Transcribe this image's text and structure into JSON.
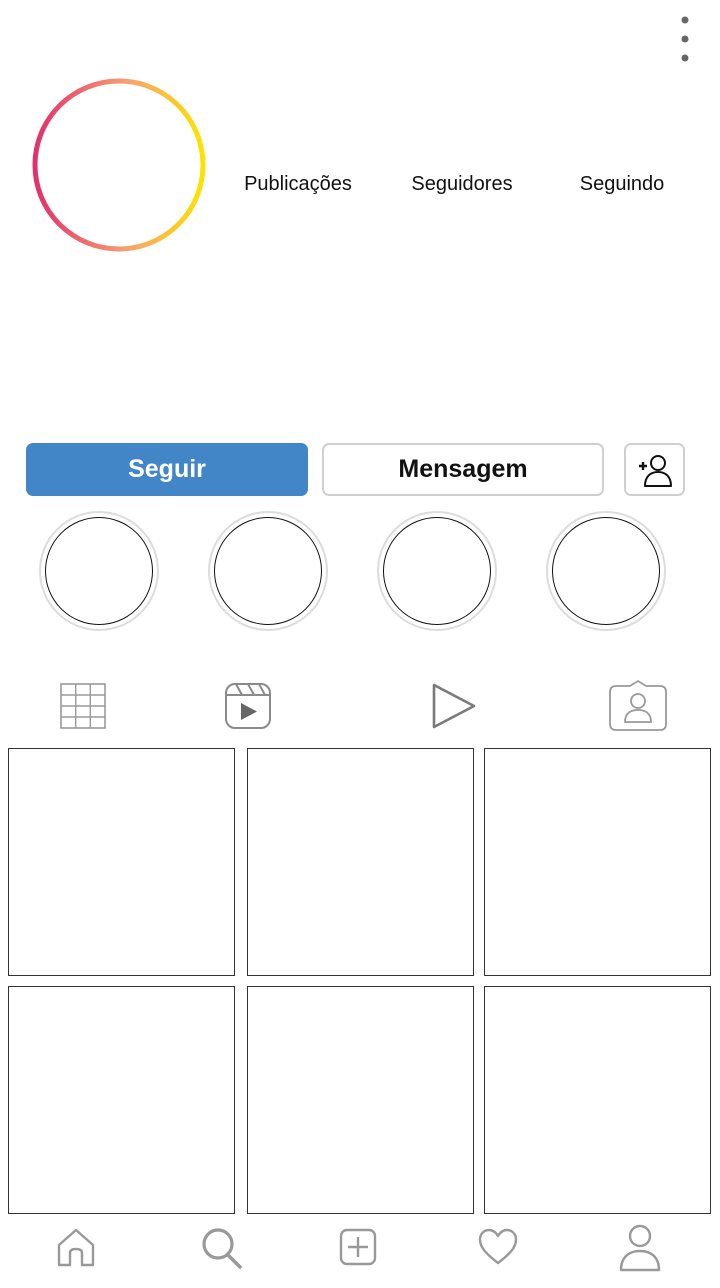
{
  "header": {
    "menu_icon": "vertical-dots-icon"
  },
  "profile": {
    "avatar_ring_colors": [
      "#e1306c",
      "#f77737",
      "#fcd700"
    ],
    "stats": [
      {
        "label": "Publicações"
      },
      {
        "label": "Seguidores"
      },
      {
        "label": "Seguindo"
      }
    ]
  },
  "actions": {
    "follow_label": "Seguir",
    "message_label": "Mensagem",
    "add_user_icon": "add-user-icon",
    "follow_color": "#4286c8"
  },
  "highlights": [
    {},
    {},
    {},
    {}
  ],
  "tabs": [
    {
      "icon": "grid-icon"
    },
    {
      "icon": "reels-icon"
    },
    {
      "icon": "play-icon"
    },
    {
      "icon": "tagged-icon"
    }
  ],
  "posts": [
    {},
    {},
    {},
    {},
    {},
    {}
  ],
  "bottom_nav": [
    {
      "icon": "home-icon"
    },
    {
      "icon": "search-icon"
    },
    {
      "icon": "add-post-icon"
    },
    {
      "icon": "heart-icon"
    },
    {
      "icon": "profile-icon"
    }
  ]
}
